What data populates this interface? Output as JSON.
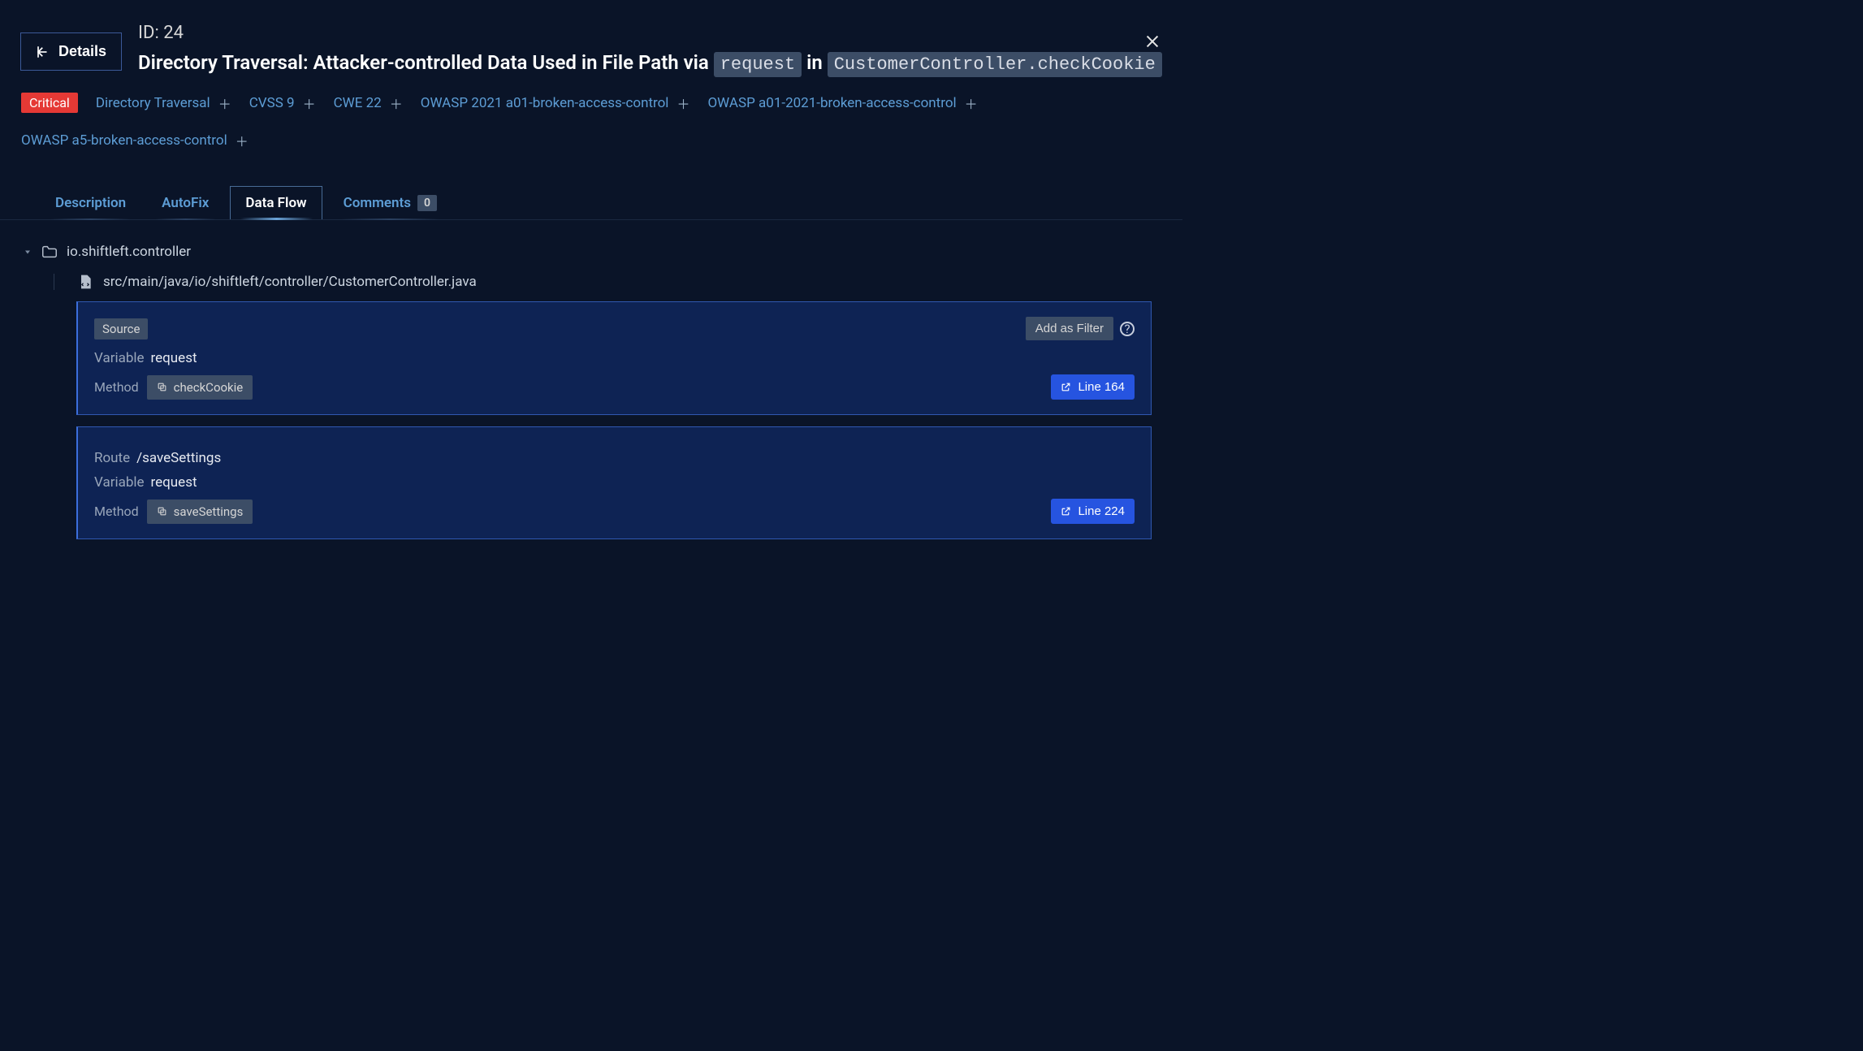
{
  "header": {
    "details_button": "Details",
    "id_label": "ID: 24",
    "title_prefix": "Directory Traversal: Attacker-controlled Data Used in File Path via ",
    "title_code1": "request",
    "title_mid": " in ",
    "title_code2": "CustomerController.checkCookie"
  },
  "tags": {
    "severity": "Critical",
    "items": [
      "Directory Traversal",
      "CVSS 9",
      "CWE 22",
      "OWASP 2021 a01-broken-access-control",
      "OWASP a01-2021-broken-access-control",
      "OWASP a5-broken-access-control"
    ]
  },
  "tabs": {
    "description": "Description",
    "autofix": "AutoFix",
    "dataflow": "Data Flow",
    "comments": "Comments",
    "comments_count": "0"
  },
  "tree": {
    "package": "io.shiftleft.controller",
    "file": "src/main/java/io/shiftleft/controller/CustomerController.java"
  },
  "cards": [
    {
      "source_badge": "Source",
      "add_filter": "Add as Filter",
      "variable_label": "Variable",
      "variable_value": "request",
      "method_label": "Method",
      "method_value": "checkCookie",
      "line_label": "Line 164"
    },
    {
      "route_label": "Route",
      "route_value": "/saveSettings",
      "variable_label": "Variable",
      "variable_value": "request",
      "method_label": "Method",
      "method_value": "saveSettings",
      "line_label": "Line 224"
    }
  ]
}
